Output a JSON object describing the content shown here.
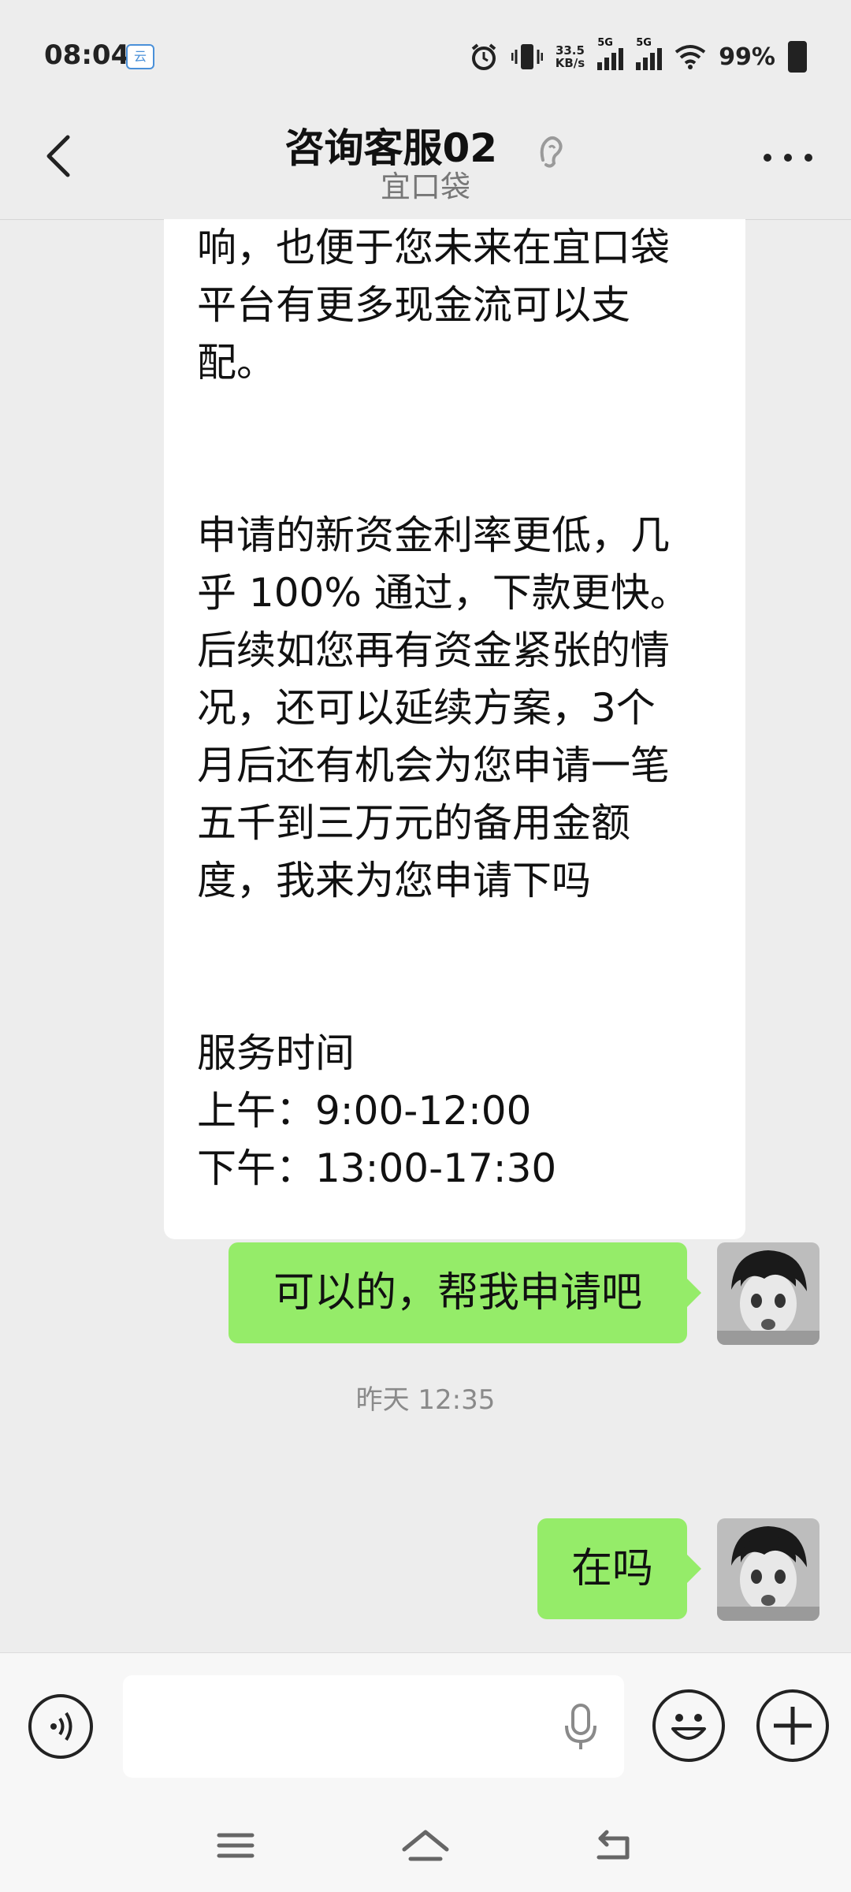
{
  "status_bar": {
    "time": "08:04",
    "cloud_badge": "云",
    "net_speed_value": "33.5",
    "net_speed_unit": "KB/s",
    "signal_1": "5G",
    "signal_2": "5G",
    "battery": "99%"
  },
  "header": {
    "title": "咨询客服02",
    "subtitle": "宜口袋"
  },
  "messages": {
    "incoming_lines": [
      "响，也便于您未来在宜口袋",
      "平台有更多现金流可以支",
      "配。",
      "",
      "",
      "申请的新资金利率更低，几",
      "乎 100% 通过，下款更快。",
      "后续如您再有资金紧张的情",
      "况，还可以延续方案，3个",
      "月后还有机会为您申请一笔",
      "五千到三万元的备用金额",
      "度，我来为您申请下吗",
      "",
      "",
      "服务时间",
      "上午：9:00-12:00",
      "下午：13:00-17:30"
    ],
    "outgoing_1": "可以的，帮我申请吧",
    "timestamp": "昨天 12:35",
    "outgoing_2": "在吗"
  },
  "colors": {
    "background": "#ededed",
    "outgoing_bubble": "#95ec69",
    "incoming_bubble": "#ffffff"
  },
  "icons": [
    "back-icon",
    "ear-icon",
    "more-icon",
    "voice-icon",
    "mic-icon",
    "emoji-icon",
    "plus-icon",
    "menu-icon",
    "home-icon",
    "back-nav-icon"
  ]
}
